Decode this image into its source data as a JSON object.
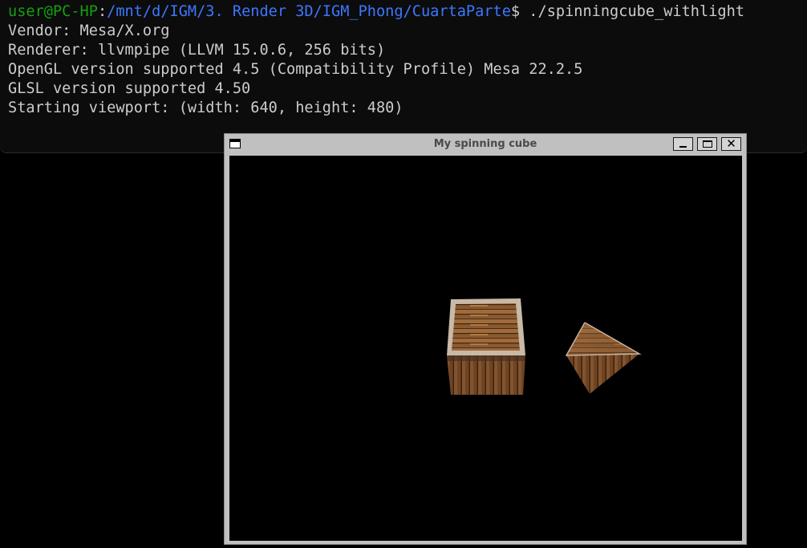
{
  "terminal": {
    "prompt": {
      "user_host": "user@PC-HP",
      "separator": ":",
      "path": "/mnt/d/IGM/3. Render 3D/IGM_Phong/CuartaParte",
      "symbol": "$",
      "command": " ./spinningcube_withlight"
    },
    "output_lines": [
      "Vendor: Mesa/X.org",
      "Renderer: llvmpipe (LLVM 15.0.6, 256 bits)",
      "OpenGL version supported 4.5 (Compatibility Profile) Mesa 22.2.5",
      "GLSL version supported 4.50",
      "Starting viewport: (width: 640, height: 480)"
    ],
    "colors": {
      "background": "#0c0c0c",
      "text": "#cccccc",
      "user_host": "#13a10e",
      "path": "#3b78ff"
    }
  },
  "window": {
    "title": "My spinning cube",
    "icons": {
      "menu": "window-menu-icon",
      "minimize": "minimize-icon",
      "maximize": "maximize-icon",
      "close": "close-icon"
    },
    "close_glyph": "✕",
    "colors": {
      "frame": "#c0c0c0",
      "title_text": "#4a4a4a",
      "viewport": "#000000"
    }
  },
  "scene": {
    "objects": [
      "wooden-crate",
      "wooden-crate-tilted"
    ],
    "colors": {
      "wood_light": "#9c6a3c",
      "wood_dark": "#5a3a1e",
      "frame_edge": "#c9bfb4"
    }
  }
}
